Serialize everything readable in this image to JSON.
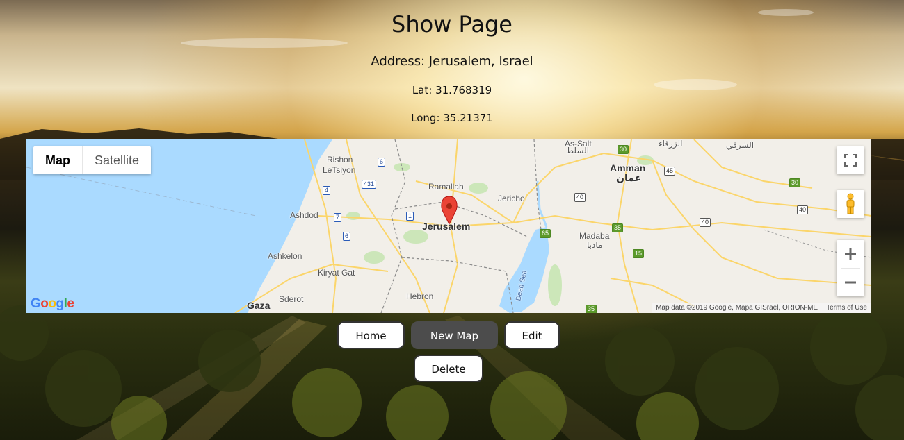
{
  "page": {
    "title": "Show Page",
    "address": "Address: Jerusalem, Israel",
    "lat": "Lat: 31.768319",
    "long": "Long: 35.21371"
  },
  "map": {
    "type_options": [
      "Map",
      "Satellite"
    ],
    "selected_type": "Map",
    "labels": {
      "rishon": "Rishon",
      "letsiyon": "LeTsiyon",
      "ramallah": "Ramallah",
      "jericho": "Jericho",
      "jerusalem": "Jerusalem",
      "ashdod": "Ashdod",
      "ashkelon": "Ashkelon",
      "kiryat_gat": "Kiryat Gat",
      "hebron": "Hebron",
      "sderot": "Sderot",
      "gaza": "Gaza",
      "madaba": "Madaba",
      "madaba_ar": "مادبا",
      "amman": "Amman",
      "amman_ar": "عمان",
      "as_salt": "As-Salt",
      "as_salt_ar": "السلط",
      "zarqa_ar": "الزرقاء",
      "sharqi_ar": "الشرقي",
      "dead_sea": "Dead Sea"
    },
    "shields": {
      "r6a": "6",
      "r431": "431",
      "r4": "4",
      "r1": "1",
      "r7": "7",
      "r6b": "6",
      "r30a": "30",
      "r45": "45",
      "r30b": "30",
      "r40a": "40",
      "r40b": "40",
      "r40c": "40",
      "r65": "65",
      "r15": "15",
      "r35a": "35",
      "r35b": "35"
    },
    "logo": "Google",
    "attribution": "Map data ©2019 Google, Mapa GISrael, ORION-ME",
    "terms": "Terms of Use",
    "colors": {
      "water": "#aadaff",
      "land": "#f2efe9",
      "road": "#fbd56a",
      "park": "#c8e6b4",
      "marker": "#ea4335"
    }
  },
  "buttons": {
    "home": "Home",
    "new_map": "New Map",
    "edit": "Edit",
    "delete": "Delete"
  }
}
